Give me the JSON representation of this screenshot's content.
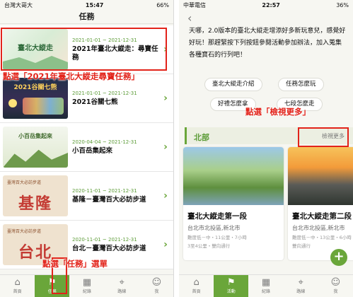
{
  "left": {
    "status": {
      "carrier": "台灣大哥大",
      "time": "15:47",
      "battery": "66%"
    },
    "title": "任務",
    "items": [
      {
        "date": "2021-01-01 ~ 2021-12-31",
        "title": "2021年臺北大縱走：尋寶任務",
        "thumb_text": "臺北大縱走"
      },
      {
        "date": "2021-01-01 ~ 2021-12-31",
        "title": "2021谷關七熊",
        "thumb_text": "2021谷關七熊"
      },
      {
        "date": "2020-04-04 ~ 2021-12-31",
        "title": "小百岳集起來",
        "thumb_text": "小百岳集起來"
      },
      {
        "date": "2020-11-01 ~ 2021-12-31",
        "title": "基隆－臺灣百大必訪步道",
        "thumb_text": "基隆",
        "thumb_sub": "臺灣百大必訪步道"
      },
      {
        "date": "2020-11-01 ~ 2021-12-31",
        "title": "台北－臺灣百大必訪步道",
        "thumb_text": "台北",
        "thumb_sub": "臺灣百大必訪步道"
      }
    ],
    "tabs": [
      "首頁",
      "任務",
      "紀錄",
      "路線",
      "我"
    ],
    "annotations": {
      "top": "點選「2021年臺北大縱走尋寶任務」",
      "bottom": "點選「任務」選單"
    }
  },
  "right": {
    "status": {
      "carrier": "中華電信",
      "time": "22:57",
      "battery": "36%"
    },
    "description": "天哪，2.0版本的臺北大縱走增添好多新玩意兒，感覺好好玩！那趕緊按下列按鈕參閱活動參加辦法，加入蒐集各種寶石的行列吧！",
    "chips": [
      "臺北大縱走介紹",
      "任務怎麼玩",
      "好禮怎麼拿",
      "七段怎麼走"
    ],
    "region": "北部",
    "more": "檢視更多",
    "cards": [
      {
        "name": "臺北大縱走第一段",
        "loc": "台北市北投區,新北市",
        "meta1": "難度低－中・11公里・7小時",
        "meta2": "3至4公里・雙向通行"
      },
      {
        "name": "臺北大縱走第二段",
        "loc": "台北市北投區,新北市",
        "meta1": "難度低－中・13公里・6小時",
        "meta2": "雙向通行"
      }
    ],
    "tabs": [
      "首頁",
      "活動",
      "紀錄",
      "路線",
      "我"
    ],
    "annotation": "點選「檢視更多」"
  },
  "colors": {
    "accent": "#6aa63a",
    "highlight": "#e2231a"
  }
}
